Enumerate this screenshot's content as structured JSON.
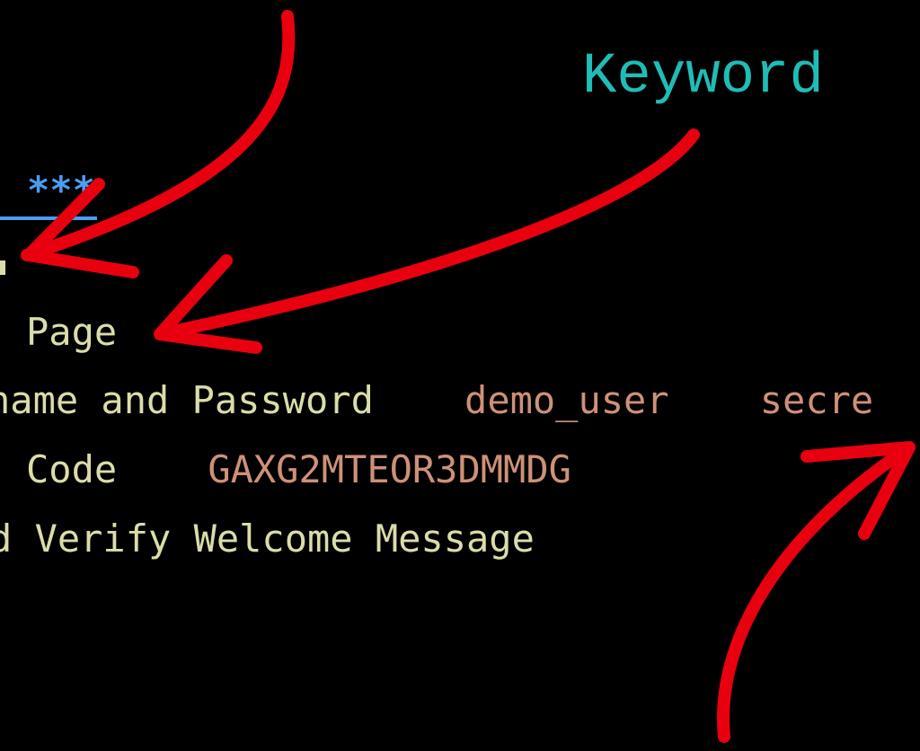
{
  "annotation": {
    "label": "Keyword"
  },
  "editor": {
    "section_header": "***",
    "lines": [
      {
        "keyword": "Page"
      },
      {
        "keyword": "name and Password",
        "args": [
          "demo_user",
          "secre"
        ]
      },
      {
        "keyword": "Code",
        "args": [
          "GAXG2MTEOR3DMMDG"
        ]
      },
      {
        "keyword": "d Verify Welcome Message"
      }
    ]
  },
  "colors": {
    "background": "#000000",
    "annotation_text": "#1fbdb6",
    "section_header": "#4d9cf0",
    "keyword": "#dcdcaa",
    "argument": "#ce9178",
    "arrow": "#e8000f"
  }
}
